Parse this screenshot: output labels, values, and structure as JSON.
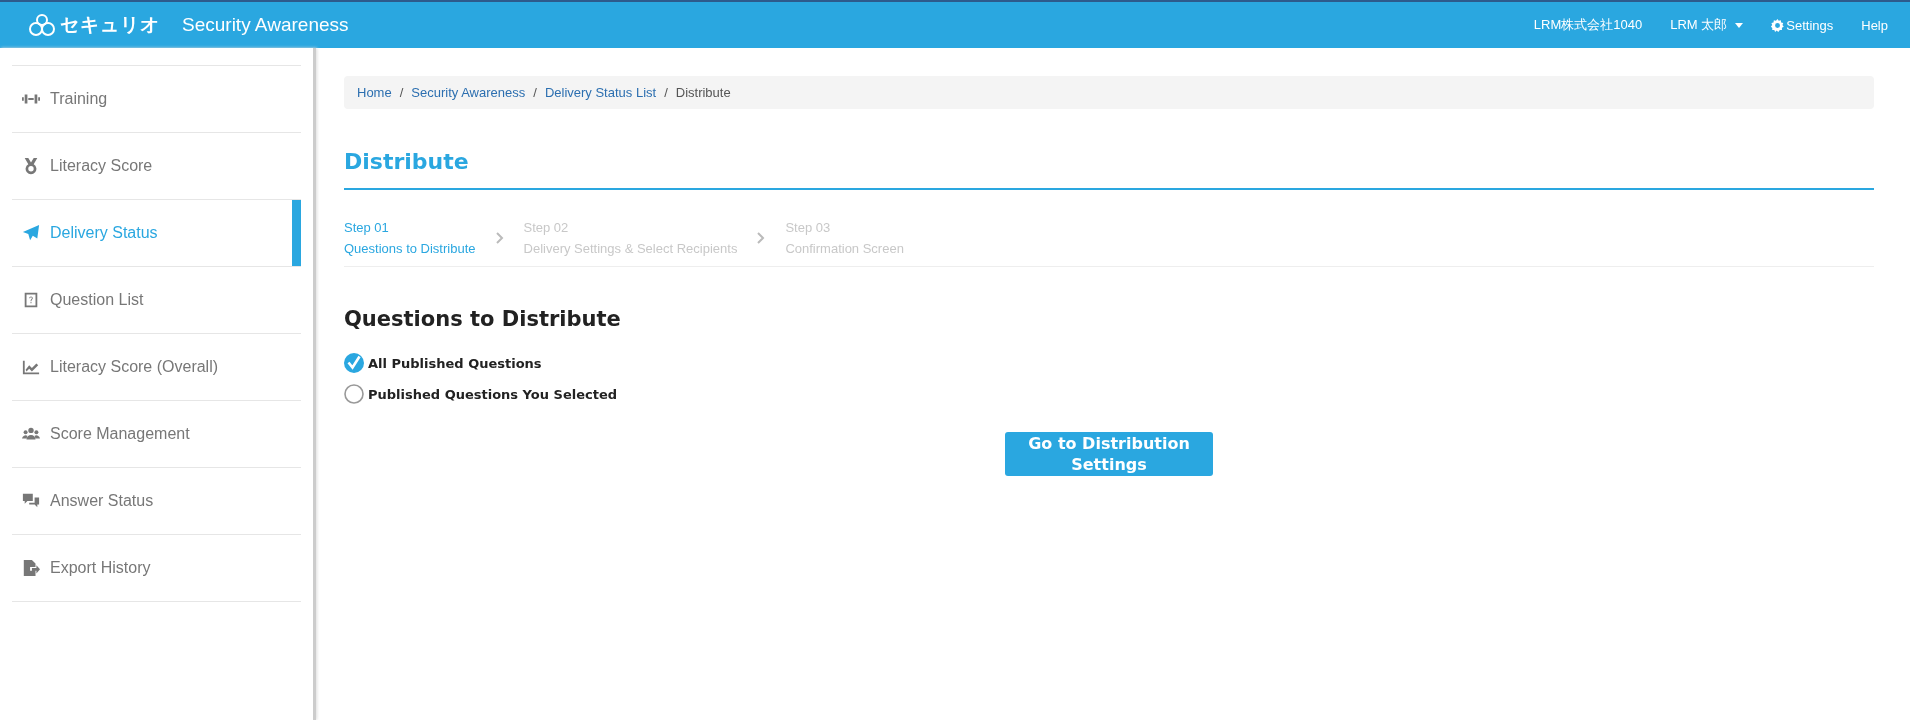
{
  "header": {
    "logo_text": "セキュリオ",
    "app_title": "Security Awareness",
    "company": "LRM株式会社1040",
    "user": "LRM 太郎",
    "settings": "Settings",
    "help": "Help"
  },
  "sidebar": {
    "items": [
      {
        "label": "Training",
        "selected": false
      },
      {
        "label": "Literacy Score",
        "selected": false
      },
      {
        "label": "Delivery Status",
        "selected": true
      },
      {
        "label": "Question List",
        "selected": false
      },
      {
        "label": "Literacy Score (Overall)",
        "selected": false
      },
      {
        "label": "Score Management",
        "selected": false
      },
      {
        "label": "Answer Status",
        "selected": false
      },
      {
        "label": "Export History",
        "selected": false
      }
    ]
  },
  "breadcrumb_separator": "/",
  "breadcrumb": [
    "Home",
    "Security Awareness",
    "Delivery Status List",
    "Distribute"
  ],
  "page_title": "Distribute",
  "steps": [
    {
      "number": "Step 01",
      "label": "Questions to Distribute",
      "selected": true
    },
    {
      "number": "Step 02",
      "label": "Delivery Settings & Select Recipients",
      "selected": false
    },
    {
      "number": "Step 03",
      "label": "Confirmation Screen",
      "selected": false
    }
  ],
  "section_title": "Questions to Distribute",
  "options": [
    {
      "label": "All Published Questions",
      "selected": true
    },
    {
      "label": "Published Questions You Selected",
      "selected": false
    }
  ],
  "next_button": "Go to Distribution Settings"
}
